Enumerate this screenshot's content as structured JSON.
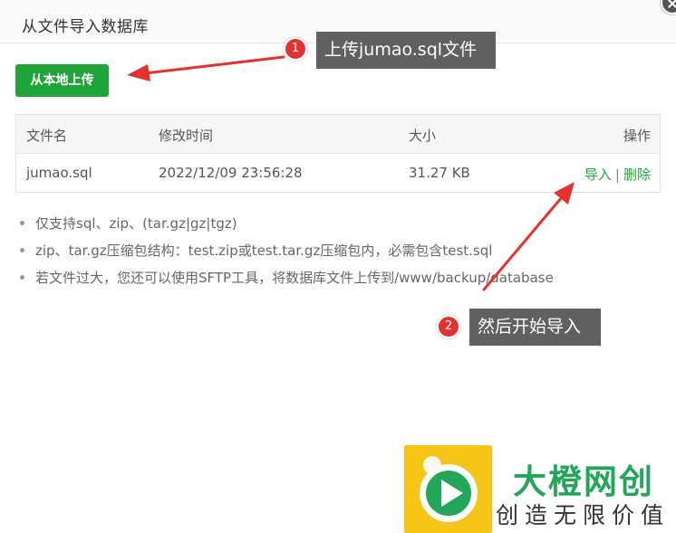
{
  "dialog": {
    "title": "从文件导入数据库"
  },
  "toolbar": {
    "upload_label": "从本地上传"
  },
  "table": {
    "headers": {
      "name": "文件名",
      "time": "修改时间",
      "size": "大小",
      "ops": "操作"
    },
    "rows": [
      {
        "name": "jumao.sql",
        "time": "2022/12/09 23:56:28",
        "size": "31.27 KB",
        "import_label": "导入",
        "separator": "|",
        "delete_label": "删除"
      }
    ]
  },
  "notes": [
    "仅支持sql、zip、(tar.gz|gz|tgz)",
    "zip、tar.gz压缩包结构：test.zip或test.tar.gz压缩包内，必需包含test.sql",
    "若文件过大，您还可以使用SFTP工具，将数据库文件上传到/www/backup/database"
  ],
  "annotations": [
    {
      "number": "1",
      "text": "上传jumao.sql文件"
    },
    {
      "number": "2",
      "text": "然后开始导入"
    }
  ],
  "watermark": {
    "name": "大橙网创",
    "slogan": "创造无限价值"
  },
  "colors": {
    "accent_green": "#20a53a",
    "annotation_red": "#e4332e",
    "callout_gray": "#606060",
    "watermark_yellow": "#f5c417",
    "watermark_green": "#23a55a"
  }
}
